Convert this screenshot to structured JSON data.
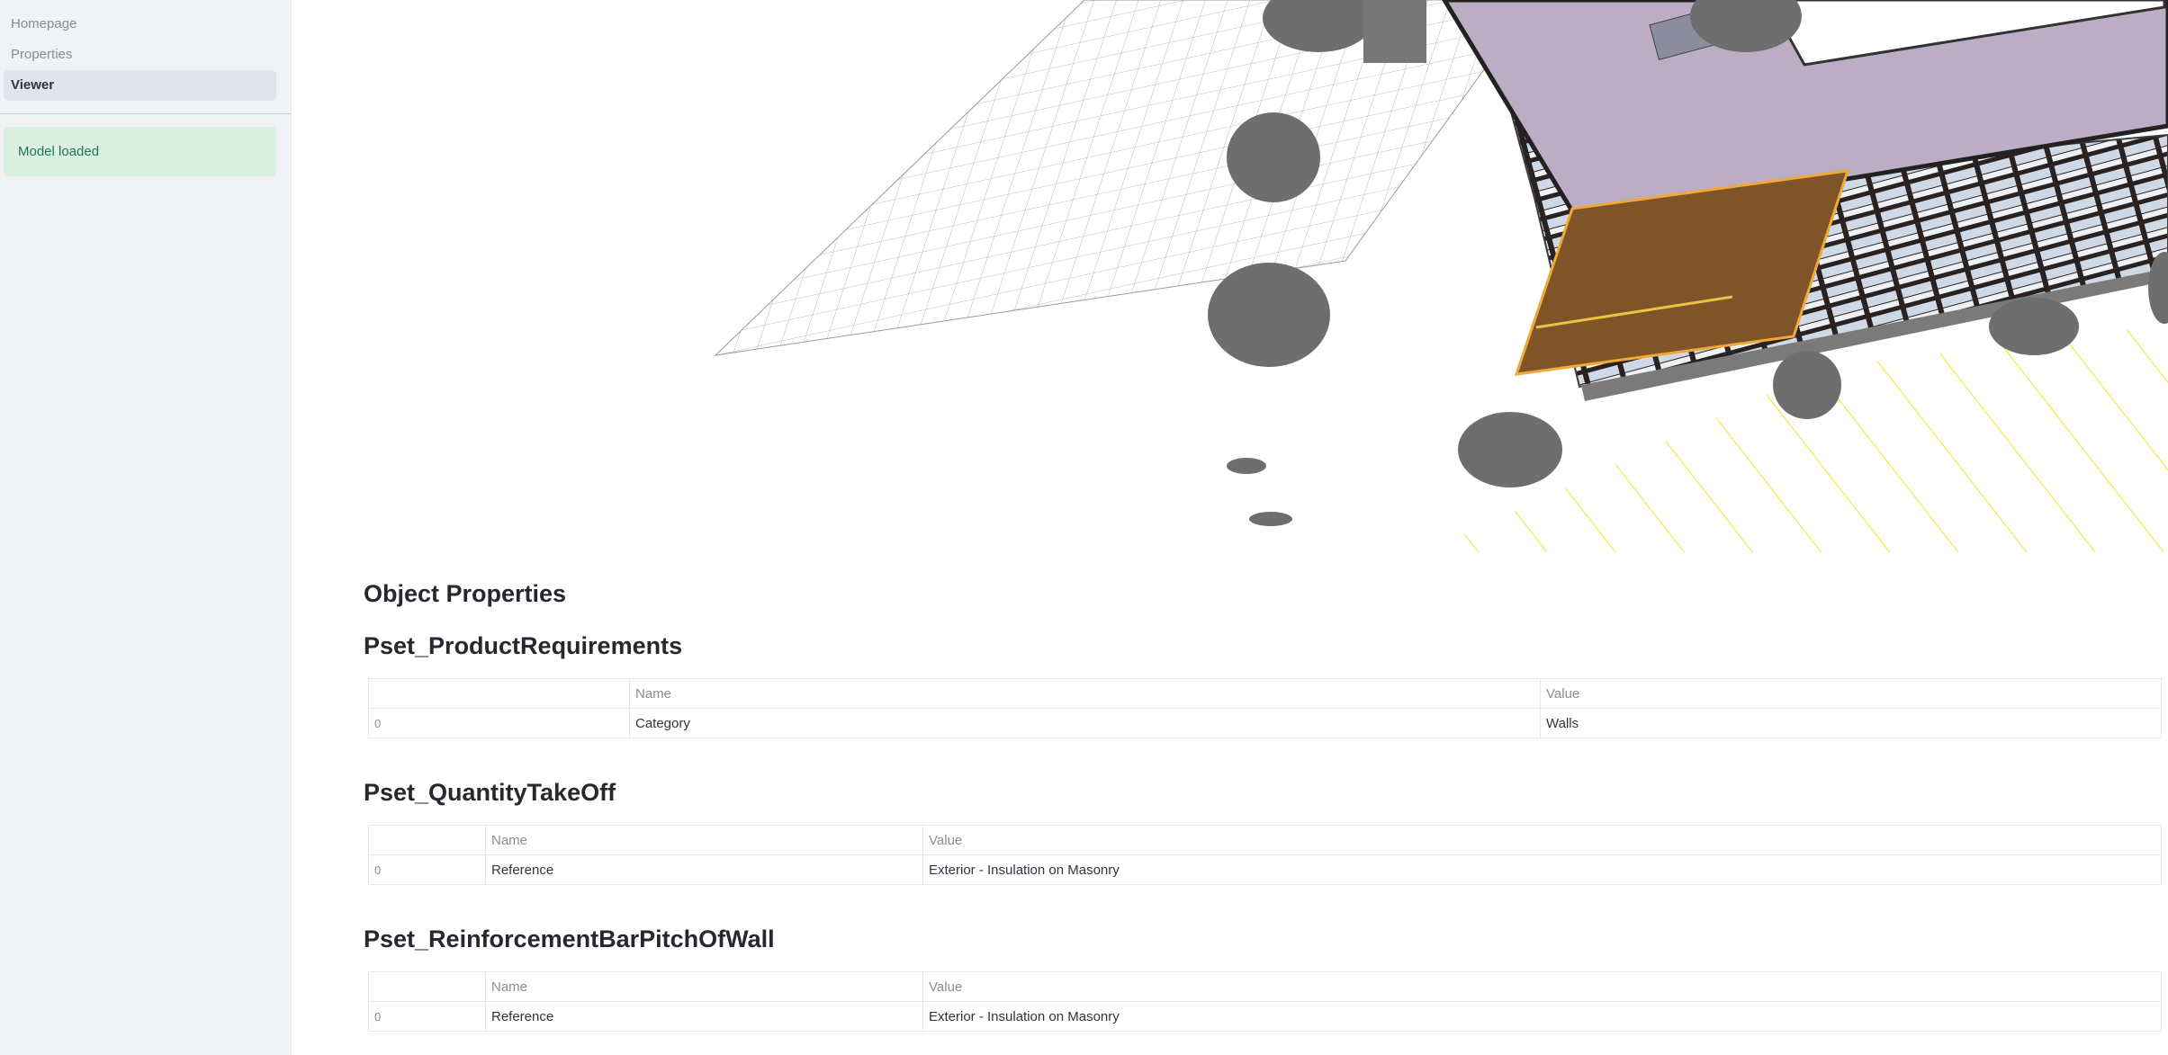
{
  "sidebar": {
    "nav": [
      {
        "label": "Homepage"
      },
      {
        "label": "Properties"
      },
      {
        "label": "Viewer"
      }
    ],
    "status": "Model loaded"
  },
  "main": {
    "title": "Object Properties",
    "psets": [
      {
        "name": "Pset_ProductRequirements",
        "columns": [
          "",
          "Name",
          "Value"
        ],
        "rows": [
          [
            "0",
            "Category",
            "Walls"
          ]
        ]
      },
      {
        "name": "Pset_QuantityTakeOff",
        "columns": [
          "",
          "Name",
          "Value"
        ],
        "rows": [
          [
            "0",
            "Reference",
            "Exterior - Insulation on Masonry"
          ]
        ]
      },
      {
        "name": "Pset_ReinforcementBarPitchOfWall",
        "columns": [
          "",
          "Name",
          "Value"
        ],
        "rows": [
          [
            "0",
            "Reference",
            "Exterior - Insulation on Masonry"
          ]
        ]
      }
    ]
  },
  "colors": {
    "roof": "#bcadc4",
    "selected_wall": "#7e5428",
    "tree": "#6e6e6e",
    "grid": "#b4b4b4",
    "parking_lines": "#e6e600",
    "status_bg": "#dbefe3",
    "status_text": "#1f7a4a"
  }
}
